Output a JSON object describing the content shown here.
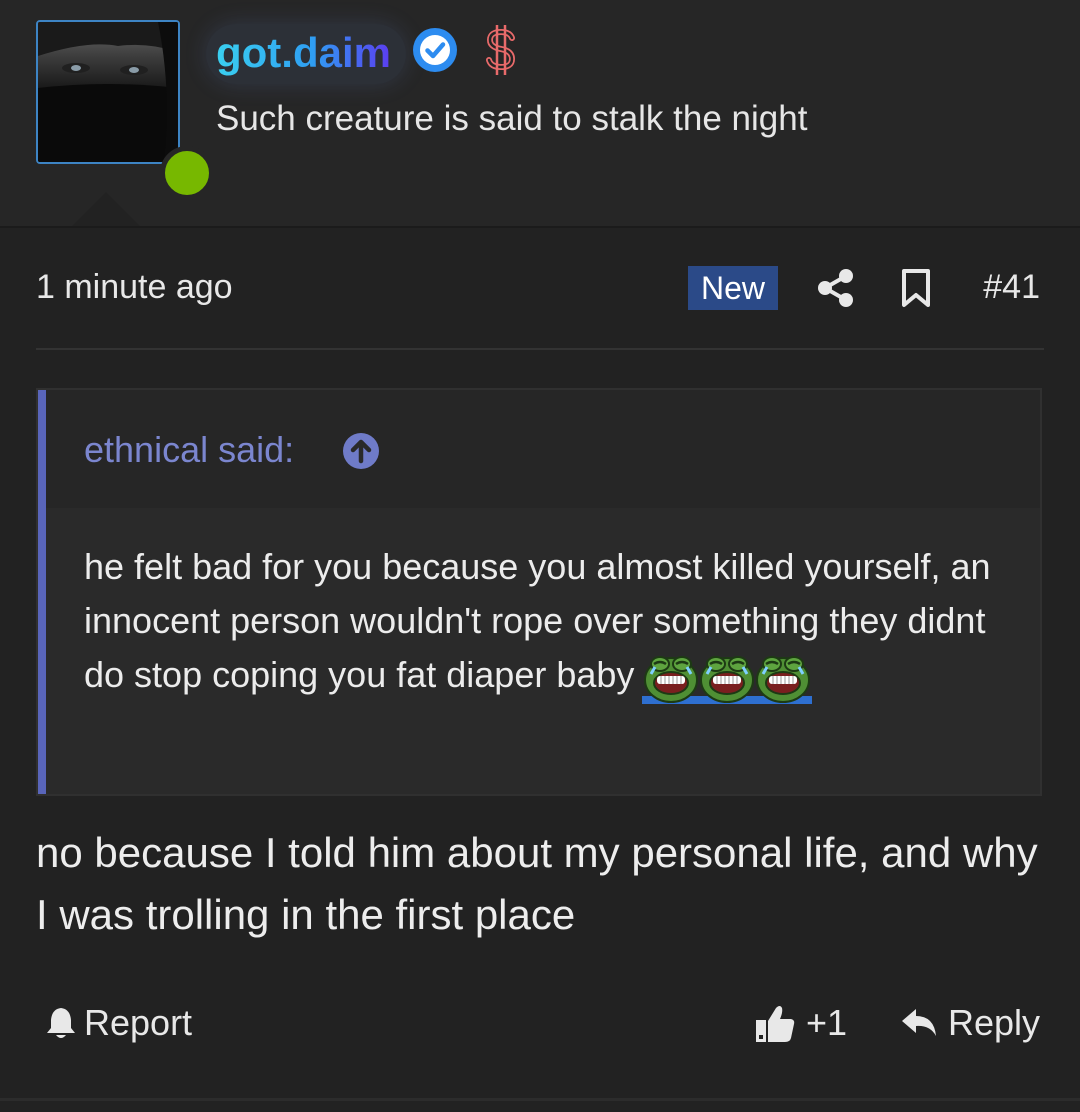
{
  "user": {
    "username": "got.daim",
    "custom_title": "Such creature is said to stalk the night",
    "status": "online",
    "avatar_icon": "avatar-image",
    "verified_icon": "verified-check-icon",
    "badge_icon": "dollar-icon",
    "username_gradient": [
      "#3ad0f0",
      "#2f9ef2",
      "#5b3df0"
    ],
    "online_color": "#77b800"
  },
  "meta": {
    "timestamp": "1 minute ago",
    "new_badge": "New",
    "post_number": "#41"
  },
  "quote": {
    "author_label": "ethnical said:",
    "body": "he felt bad for you because you almost killed yourself, an innocent person wouldn't rope over something they didnt do stop coping you fat diaper baby",
    "emotes": [
      "crying-laughing-frog-emote",
      "crying-laughing-frog-emote",
      "crying-laughing-frog-emote"
    ],
    "accent_color": "#5965ba"
  },
  "post": {
    "body": "no because I told him about my personal life, and why I was trolling in the first place"
  },
  "actions": {
    "report_label": "Report",
    "reaction_count": "+1",
    "reply_label": "Reply"
  }
}
